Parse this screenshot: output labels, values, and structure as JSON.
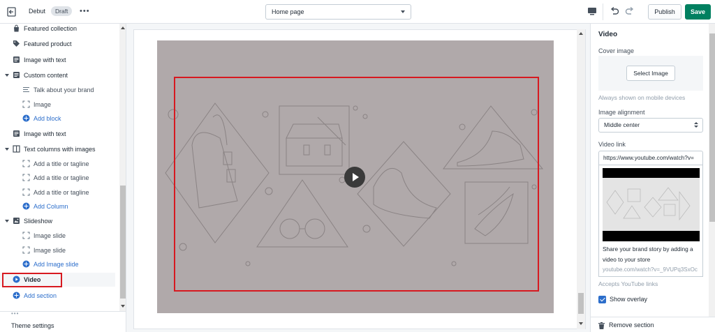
{
  "topbar": {
    "theme_name": "Debut",
    "status_badge": "Draft",
    "more": "•••",
    "page_select": "Home page",
    "publish_label": "Publish",
    "save_label": "Save"
  },
  "sidebar": {
    "items": [
      {
        "label": "Featured collection",
        "icon": "shopping-bag-icon"
      },
      {
        "label": "Featured product",
        "icon": "tag-icon"
      },
      {
        "label": "Image with text",
        "icon": "image-text-icon"
      },
      {
        "label": "Custom content",
        "icon": "image-text-icon",
        "expanded": true
      },
      {
        "label": "Talk about your brand",
        "icon": "text-lines-icon"
      },
      {
        "label": "Image",
        "icon": "image-frame-icon"
      },
      {
        "label": "Add block",
        "icon": "plus-circle-icon"
      },
      {
        "label": "Image with text",
        "icon": "image-text-icon"
      },
      {
        "label": "Text columns with images",
        "icon": "columns-icon",
        "expanded": true
      },
      {
        "label": "Add a title or tagline",
        "icon": "image-frame-icon"
      },
      {
        "label": "Add a title or tagline",
        "icon": "image-frame-icon"
      },
      {
        "label": "Add a title or tagline",
        "icon": "image-frame-icon"
      },
      {
        "label": "Add Column",
        "icon": "plus-circle-icon"
      },
      {
        "label": "Slideshow",
        "icon": "slideshow-icon",
        "expanded": true
      },
      {
        "label": "Image slide",
        "icon": "image-frame-icon"
      },
      {
        "label": "Image slide",
        "icon": "image-frame-icon"
      },
      {
        "label": "Add Image slide",
        "icon": "plus-circle-icon"
      },
      {
        "label": "Video",
        "icon": "play-circle-icon",
        "selected": true
      },
      {
        "label": "Add section",
        "icon": "plus-circle-icon"
      }
    ],
    "footer_label": "Theme settings",
    "footer_dots": "•••"
  },
  "right_panel": {
    "title": "Video",
    "cover_image_label": "Cover image",
    "select_image_button": "Select Image",
    "cover_help": "Always shown on mobile devices",
    "alignment_label": "Image alignment",
    "alignment_value": "Middle center",
    "video_link_label": "Video link",
    "video_link_value": "https://www.youtube.com/watch?v=",
    "link_card_description": "Share your brand story by adding a video to your store",
    "link_card_url": "youtube.com/watch?v=_9VUPq3SxOc",
    "link_help": "Accepts YouTube links",
    "show_overlay_label": "Show overlay",
    "show_overlay_checked": true,
    "remove_section_label": "Remove section"
  },
  "colors": {
    "accent_green": "#008060",
    "link_blue": "#2c6ecb",
    "highlight_red": "#d71920",
    "video_background": "#b0a9aa"
  }
}
